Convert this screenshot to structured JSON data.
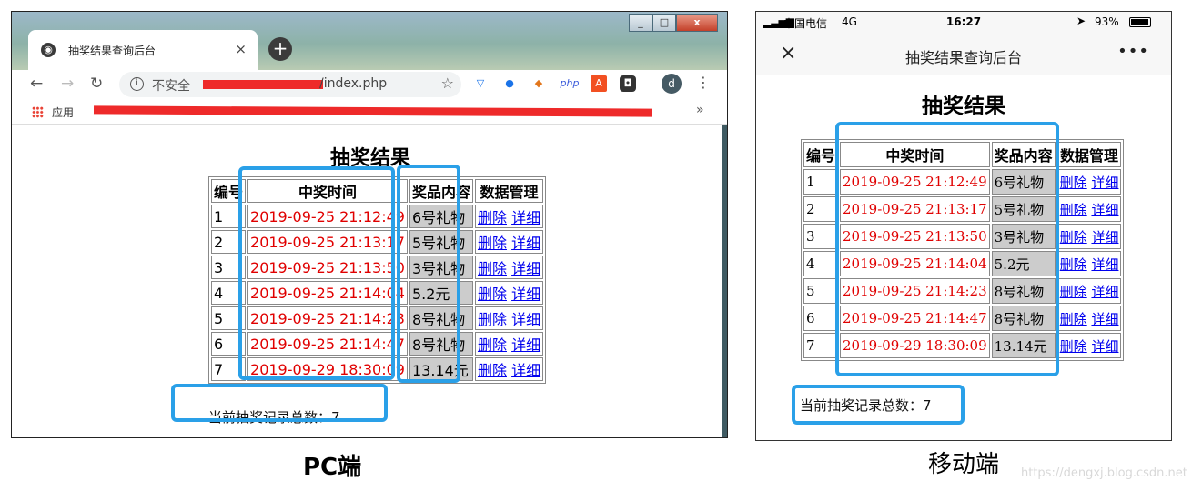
{
  "pc": {
    "tab_title": "抽奖结果查询后台",
    "tab_close": "×",
    "new_tab": "+",
    "win_min": "_",
    "win_max": "□",
    "win_close": "x",
    "nav_back": "←",
    "nav_forward": "→",
    "nav_reload": "↻",
    "insecure_label": "不安全",
    "url_tail": "/index.php",
    "star": "☆",
    "ext_php": "php",
    "avatar": "d",
    "menu": "⋮",
    "apps_label": "应用",
    "bookmarks_more": "»"
  },
  "mobile": {
    "carrier": "中国电信",
    "network": "4G",
    "time": "16:27",
    "battery": "93%",
    "close": "×",
    "title": "抽奖结果查询后台",
    "more": "•••"
  },
  "results": {
    "heading": "抽奖结果",
    "columns": [
      "编号",
      "中奖时间",
      "奖品内容",
      "数据管理"
    ],
    "rows": [
      {
        "id": "1",
        "time": "2019-09-25 21:12:49",
        "prize": "6号礼物"
      },
      {
        "id": "2",
        "time": "2019-09-25 21:13:17",
        "prize": "5号礼物"
      },
      {
        "id": "3",
        "time": "2019-09-25 21:13:50",
        "prize": "3号礼物"
      },
      {
        "id": "4",
        "time": "2019-09-25 21:14:04",
        "prize": "5.2元"
      },
      {
        "id": "5",
        "time": "2019-09-25 21:14:23",
        "prize": "8号礼物"
      },
      {
        "id": "6",
        "time": "2019-09-25 21:14:47",
        "prize": "8号礼物"
      },
      {
        "id": "7",
        "time": "2019-09-29 18:30:09",
        "prize": "13.14元"
      }
    ],
    "delete_label": "删除",
    "detail_label": "详细",
    "total_label_pc": "当前抽奖记录总数：7",
    "total_label_mobile": "当前抽奖记录总数：7"
  },
  "captions": {
    "pc": "PC端",
    "mobile": "移动端",
    "watermark": "https://dengxj.blog.csdn.net"
  },
  "colors": {
    "highlight": "#2aa0e8",
    "time_text": "#e00000",
    "prize_bg": "#cccccc",
    "link": "#0000ee"
  }
}
